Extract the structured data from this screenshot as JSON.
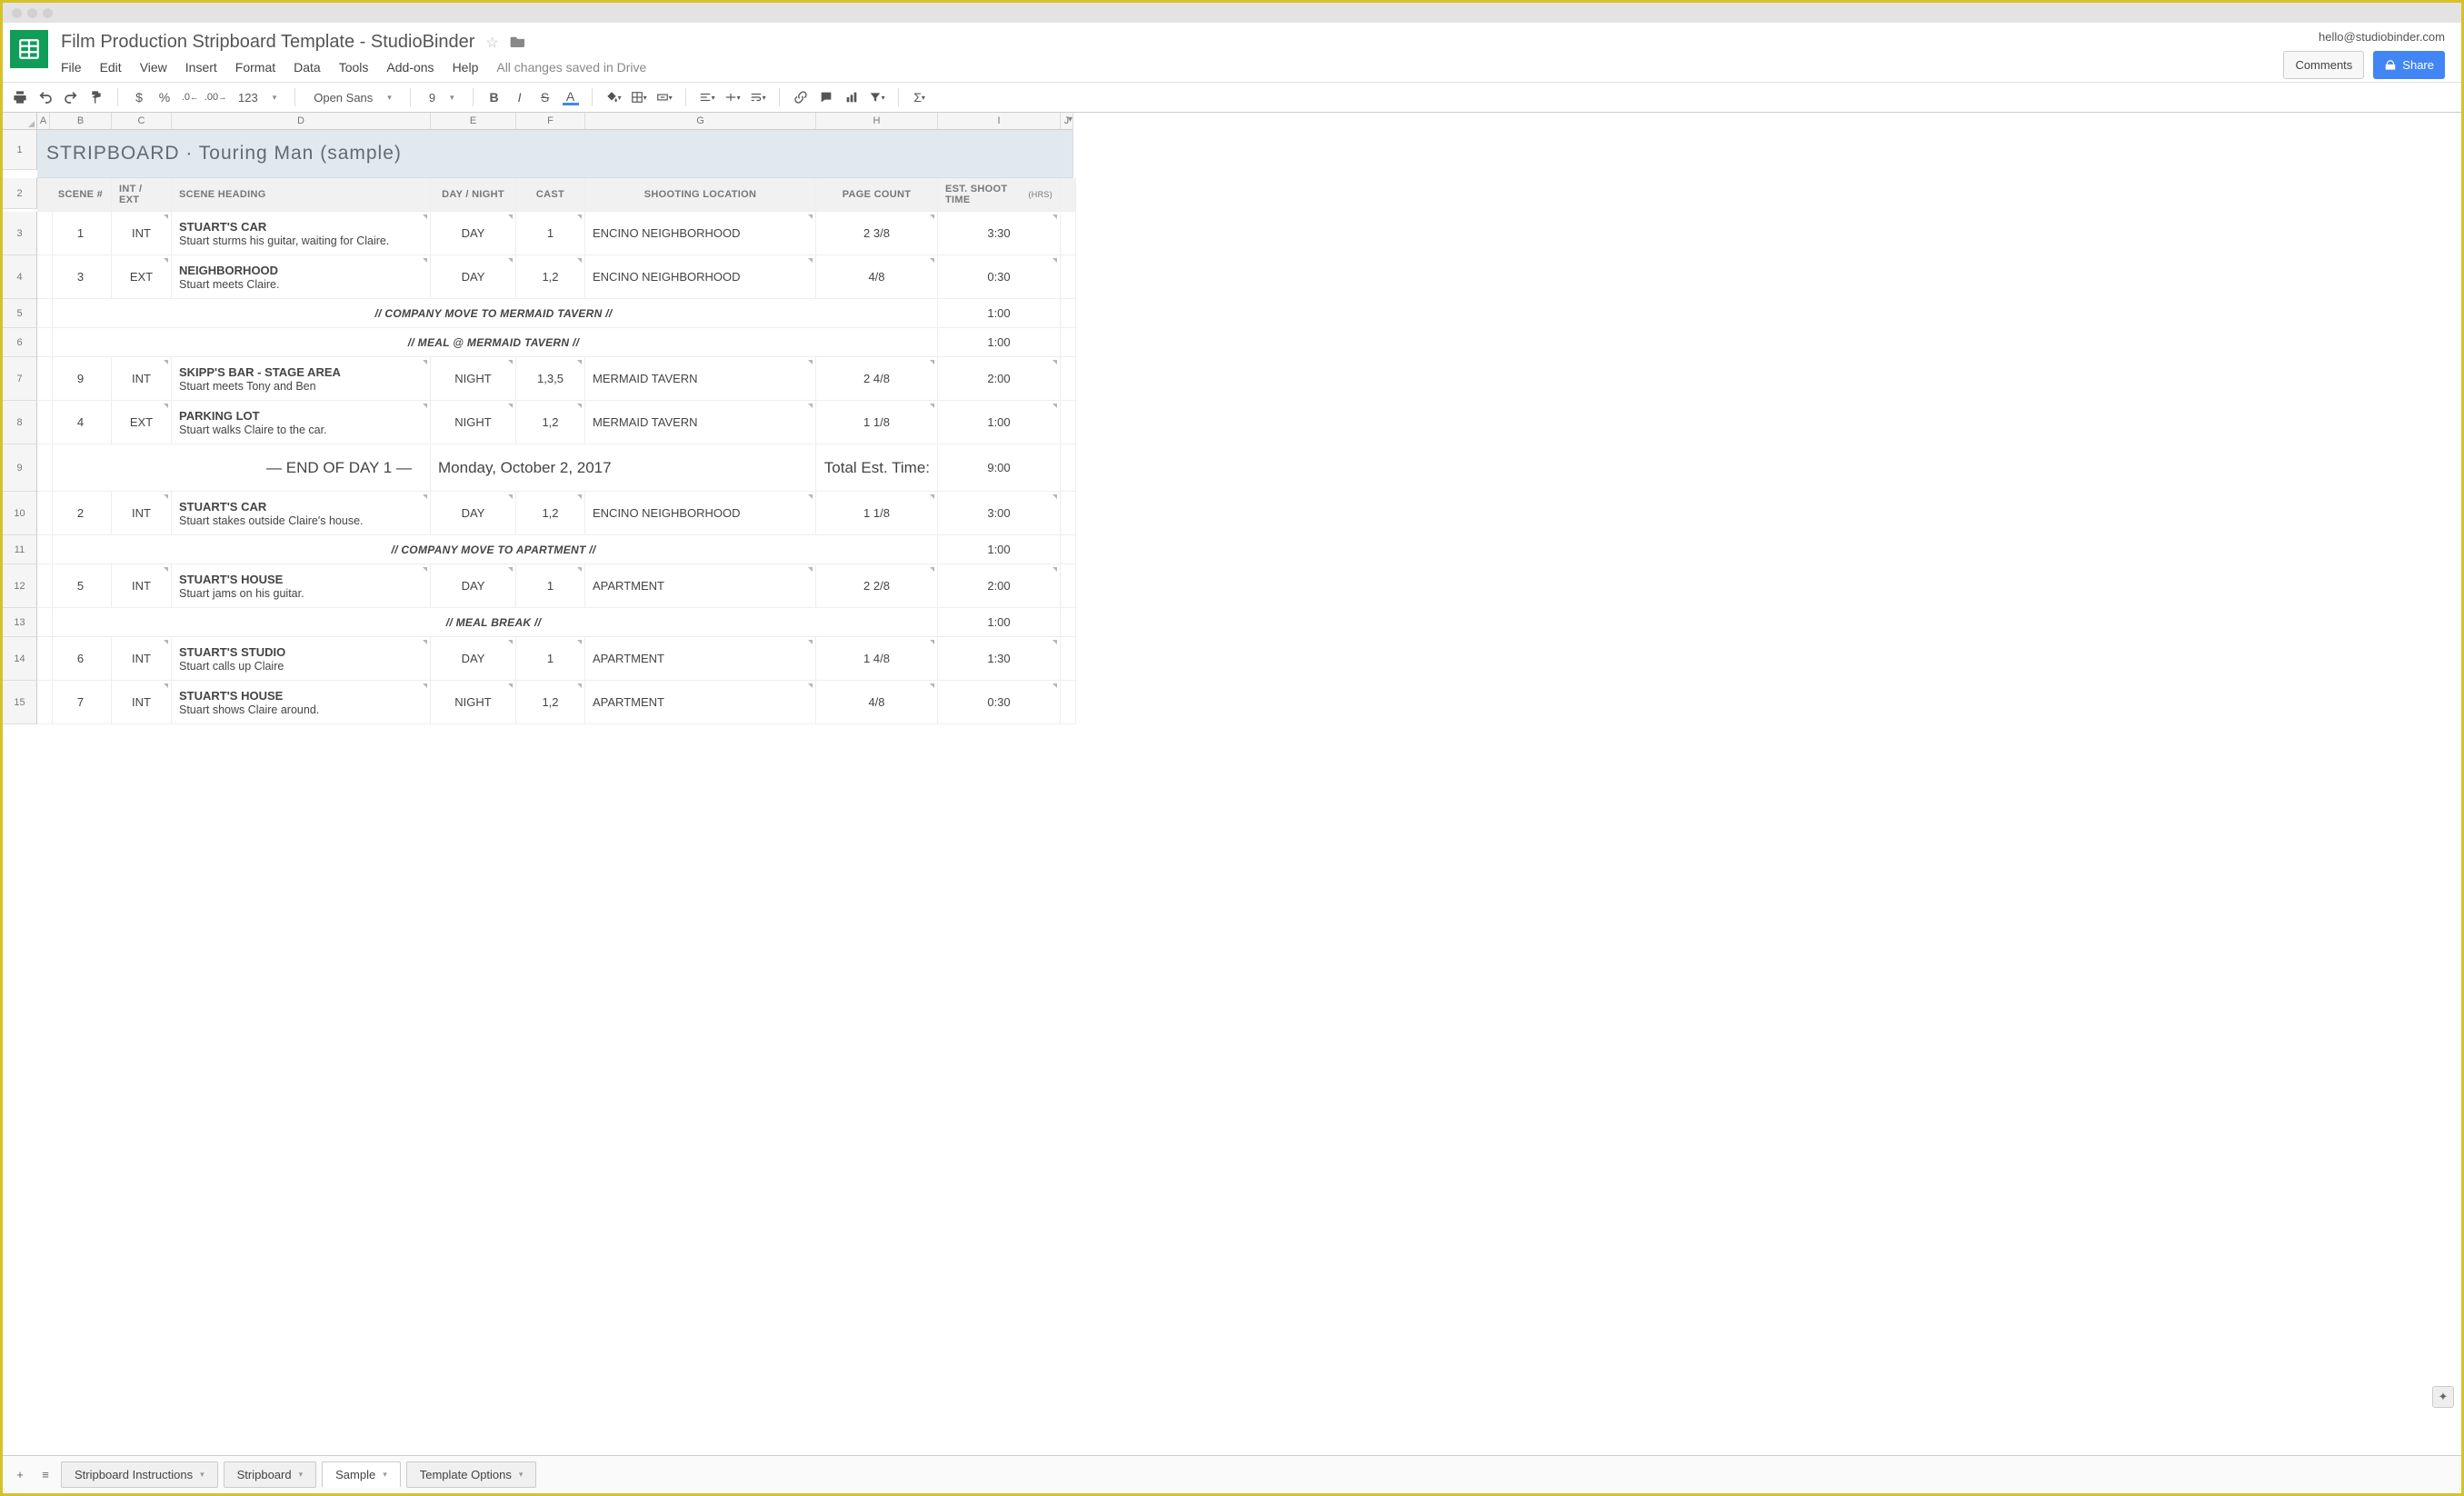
{
  "doc": {
    "title": "Film Production Stripboard Template  -  StudioBinder",
    "user_email": "hello@studiobinder.com",
    "comments_btn": "Comments",
    "share_btn": "Share",
    "saved_status": "All changes saved in Drive"
  },
  "menu": {
    "file": "File",
    "edit": "Edit",
    "view": "View",
    "insert": "Insert",
    "format": "Format",
    "data": "Data",
    "tools": "Tools",
    "addons": "Add-ons",
    "help": "Help"
  },
  "toolbar": {
    "font": "Open Sans",
    "size": "9",
    "currency": "$",
    "percent": "%",
    "dec_dec": ".0",
    "dec_inc": ".00",
    "numfmt": "123"
  },
  "cols": [
    "A",
    "B",
    "C",
    "D",
    "E",
    "F",
    "G",
    "H",
    "I",
    "J"
  ],
  "title_row": "STRIPBOARD · Touring Man (sample)",
  "headers": {
    "scene_no": "SCENE #",
    "int_ext": "INT / EXT",
    "heading": "SCENE HEADING",
    "day_night": "DAY / NIGHT",
    "cast": "CAST",
    "location": "SHOOTING LOCATION",
    "page_count": "PAGE COUNT",
    "shoot_time": "EST. SHOOT TIME",
    "shoot_time_suffix": "(HRS)"
  },
  "rows": [
    {
      "type": "scene",
      "n": "1",
      "ie": "INT",
      "head": "STUART'S CAR",
      "desc": "Stuart sturms his guitar, waiting for Claire.",
      "dn": "DAY",
      "cast": "1",
      "loc": "ENCINO NEIGHBORHOOD",
      "pc": "2 3/8",
      "time": "3:30",
      "style": "white"
    },
    {
      "type": "scene",
      "n": "3",
      "ie": "EXT",
      "head": "NEIGHBORHOOD",
      "desc": "Stuart meets Claire.",
      "dn": "DAY",
      "cast": "1,2",
      "loc": "ENCINO NEIGHBORHOOD",
      "pc": "4/8",
      "time": "0:30",
      "style": "yellow"
    },
    {
      "type": "band",
      "label": "// COMPANY MOVE TO MERMAID TAVERN //",
      "time": "1:00",
      "style": "brown"
    },
    {
      "type": "band",
      "label": "// MEAL @ MERMAID TAVERN //",
      "time": "1:00",
      "style": "brown"
    },
    {
      "type": "scene",
      "n": "9",
      "ie": "INT",
      "head": "SKIPP'S BAR - STAGE AREA",
      "desc": "Stuart meets Tony and Ben",
      "dn": "NIGHT",
      "cast": "1,3,5",
      "loc": "MERMAID TAVERN",
      "pc": "2 4/8",
      "time": "2:00",
      "style": "blue"
    },
    {
      "type": "scene",
      "n": "4",
      "ie": "EXT",
      "head": "PARKING LOT",
      "desc": "Stuart walks Claire to the car.",
      "dn": "NIGHT",
      "cast": "1,2",
      "loc": "MERMAID TAVERN",
      "pc": "1 1/8",
      "time": "1:00",
      "style": "teal"
    },
    {
      "type": "eod",
      "label": "— END OF DAY 1 —",
      "date": "Monday, October 2, 2017",
      "total_label": "Total Est. Time:",
      "total": "9:00"
    },
    {
      "type": "scene",
      "n": "2",
      "ie": "INT",
      "head": "STUART'S CAR",
      "desc": "Stuart stakes outside Claire's house.",
      "dn": "DAY",
      "cast": "1,2",
      "loc": "ENCINO NEIGHBORHOOD",
      "pc": "1 1/8",
      "time": "3:00",
      "style": "white"
    },
    {
      "type": "band",
      "label": "// COMPANY MOVE TO APARTMENT //",
      "time": "1:00",
      "style": "brown"
    },
    {
      "type": "scene",
      "n": "5",
      "ie": "INT",
      "head": "STUART'S HOUSE",
      "desc": "Stuart jams on his guitar.",
      "dn": "DAY",
      "cast": "1",
      "loc": "APARTMENT",
      "pc": "2 2/8",
      "time": "2:00",
      "style": "white"
    },
    {
      "type": "band",
      "label": "// MEAL BREAK //",
      "time": "1:00",
      "style": "brown"
    },
    {
      "type": "scene",
      "n": "6",
      "ie": "INT",
      "head": "STUART'S STUDIO",
      "desc": "Stuart calls up Claire",
      "dn": "DAY",
      "cast": "1",
      "loc": "APARTMENT",
      "pc": "1 4/8",
      "time": "1:30",
      "style": "white"
    },
    {
      "type": "scene",
      "n": "7",
      "ie": "INT",
      "head": "STUART'S HOUSE",
      "desc": "Stuart shows Claire around.",
      "dn": "NIGHT",
      "cast": "1,2",
      "loc": "APARTMENT",
      "pc": "4/8",
      "time": "0:30",
      "style": "blue2"
    }
  ],
  "tabs": {
    "t1": "Stripboard Instructions",
    "t2": "Stripboard",
    "t3": "Sample",
    "t4": "Template Options"
  }
}
